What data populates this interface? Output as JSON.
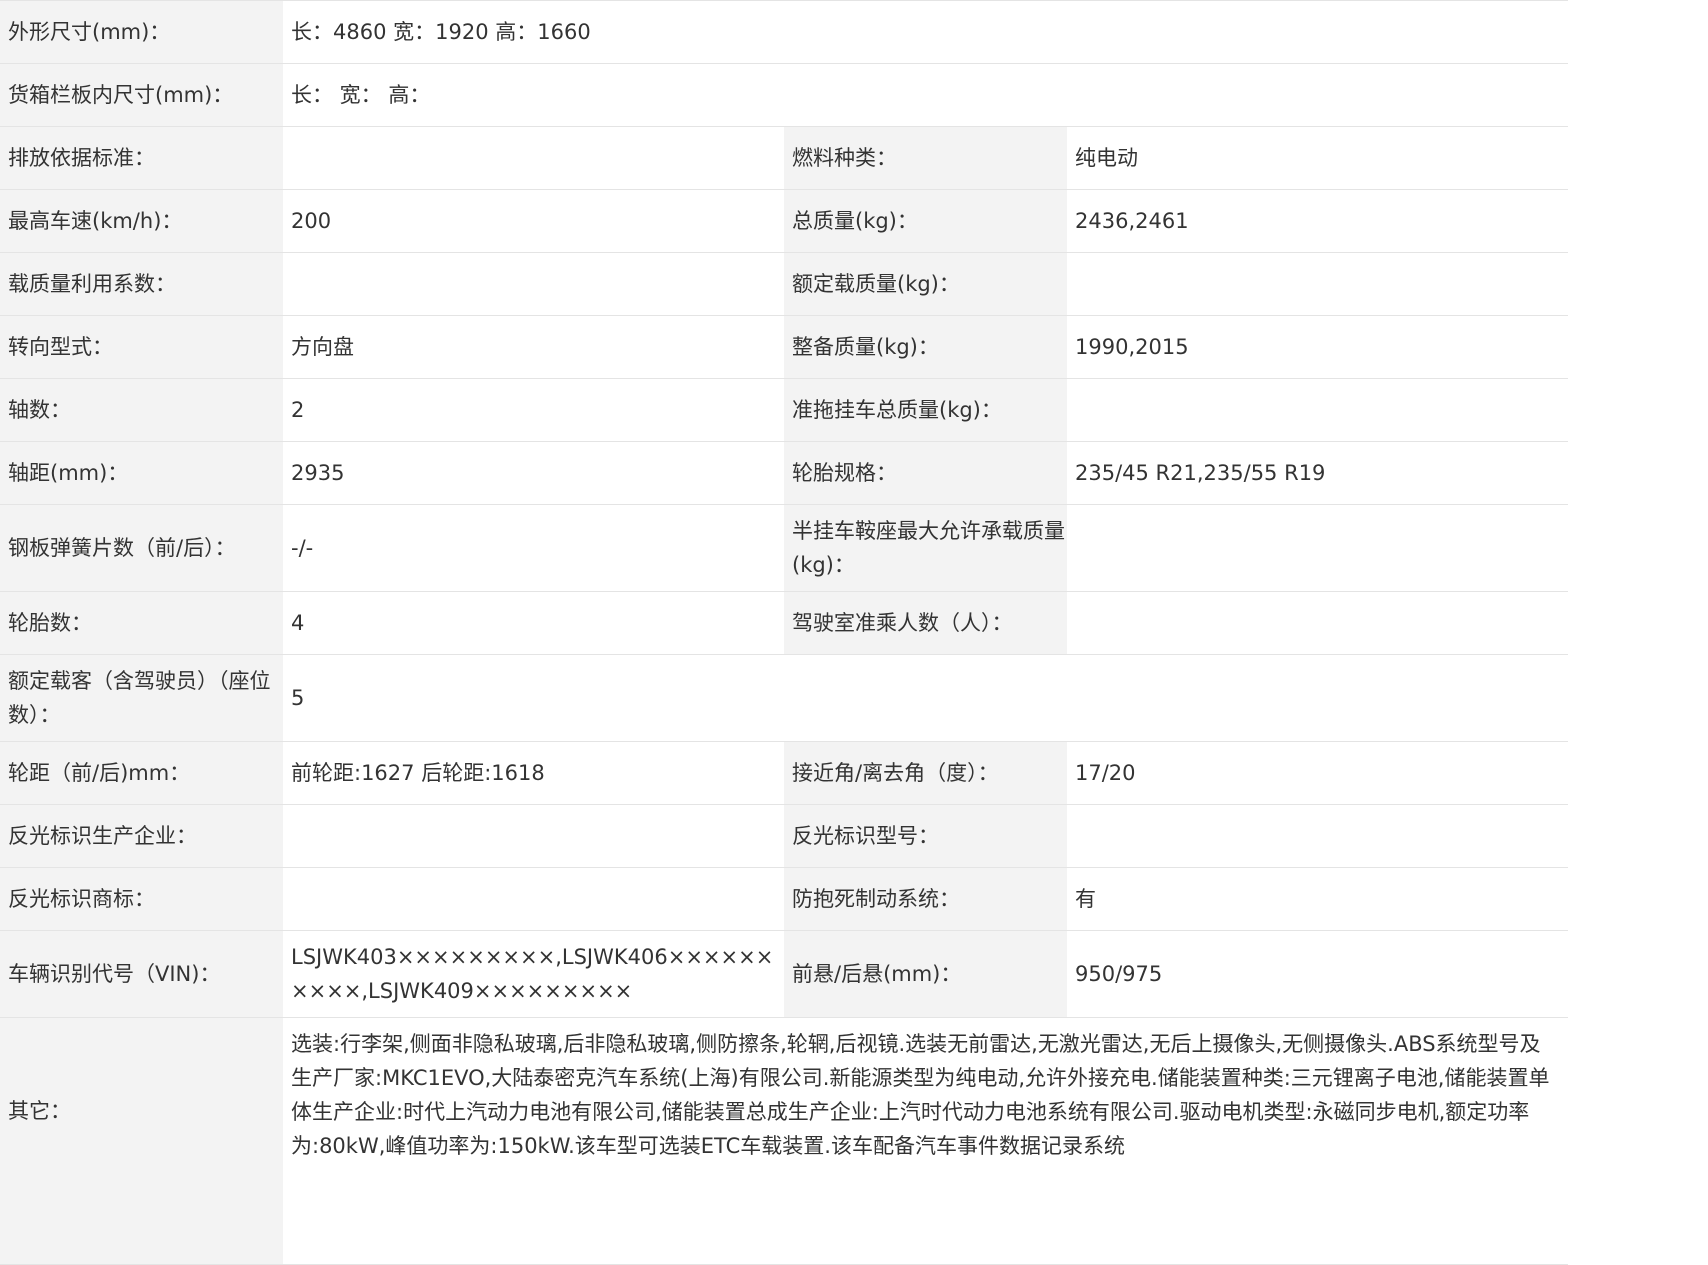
{
  "rows": {
    "dims": {
      "label": "外形尺寸(mm)：",
      "value": "长：4860 宽：1920 高：1660"
    },
    "cargo": {
      "label": "货箱栏板内尺寸(mm)：",
      "value": "长：  宽：  高："
    },
    "r3": {
      "l1": "排放依据标准：",
      "v1": "",
      "l2": "燃料种类：",
      "v2": "纯电动"
    },
    "r4": {
      "l1": "最高车速(km/h)：",
      "v1": "200",
      "l2": "总质量(kg)：",
      "v2": "2436,2461"
    },
    "r5": {
      "l1": "载质量利用系数：",
      "v1": "",
      "l2": "额定载质量(kg)：",
      "v2": ""
    },
    "r6": {
      "l1": "转向型式：",
      "v1": "方向盘",
      "l2": "整备质量(kg)：",
      "v2": "1990,2015"
    },
    "r7": {
      "l1": "轴数：",
      "v1": "2",
      "l2": "准拖挂车总质量(kg)：",
      "v2": ""
    },
    "r8": {
      "l1": "轴距(mm)：",
      "v1": "2935",
      "l2": "轮胎规格：",
      "v2": "235/45 R21,235/55 R19"
    },
    "r9": {
      "l1": "钢板弹簧片数（前/后）：",
      "v1": "-/-",
      "l2": "半挂车鞍座最大允许承载质量(kg)：",
      "v2": ""
    },
    "r10": {
      "l1": "轮胎数：",
      "v1": "4",
      "l2": "驾驶室准乘人数（人）：",
      "v2": ""
    },
    "r11": {
      "label": "额定载客（含驾驶员）（座位数）：",
      "value": "5"
    },
    "r12": {
      "l1": "轮距（前/后)mm：",
      "v1": "前轮距:1627 后轮距:1618",
      "l2": "接近角/离去角（度）：",
      "v2": "17/20"
    },
    "r13": {
      "l1": "反光标识生产企业：",
      "v1": "",
      "l2": "反光标识型号：",
      "v2": ""
    },
    "r14": {
      "l1": "反光标识商标：",
      "v1": "",
      "l2": "防抱死制动系统：",
      "v2": "有"
    },
    "r15": {
      "l1": "车辆识别代号（VIN)：",
      "v1": "LSJWK403×××××××××,LSJWK406××××××××××,LSJWK409×××××××××",
      "l2": "前悬/后悬(mm)：",
      "v2": "950/975"
    },
    "other": {
      "label": "其它：",
      "value": "选装:行李架,侧面非隐私玻璃,后非隐私玻璃,侧防擦条,轮辋,后视镜.选装无前雷达,无激光雷达,无后上摄像头,无侧摄像头.ABS系统型号及生产厂家:MKC1EVO,大陆泰密克汽车系统(上海)有限公司.新能源类型为纯电动,允许外接充电.储能装置种类:三元锂离子电池,储能装置单体生产企业:时代上汽动力电池有限公司,储能装置总成生产企业:上汽时代动力电池系统有限公司.驱动电机类型:永磁同步电机,额定功率为:80kW,峰值功率为:150kW.该车型可选装ETC车载装置.该车配备汽车事件数据记录系统"
    }
  },
  "colors": {
    "label_bg": "#f3f3f3",
    "value_bg": "#ffffff",
    "border": "#e4e4e4",
    "text": "#333333"
  }
}
